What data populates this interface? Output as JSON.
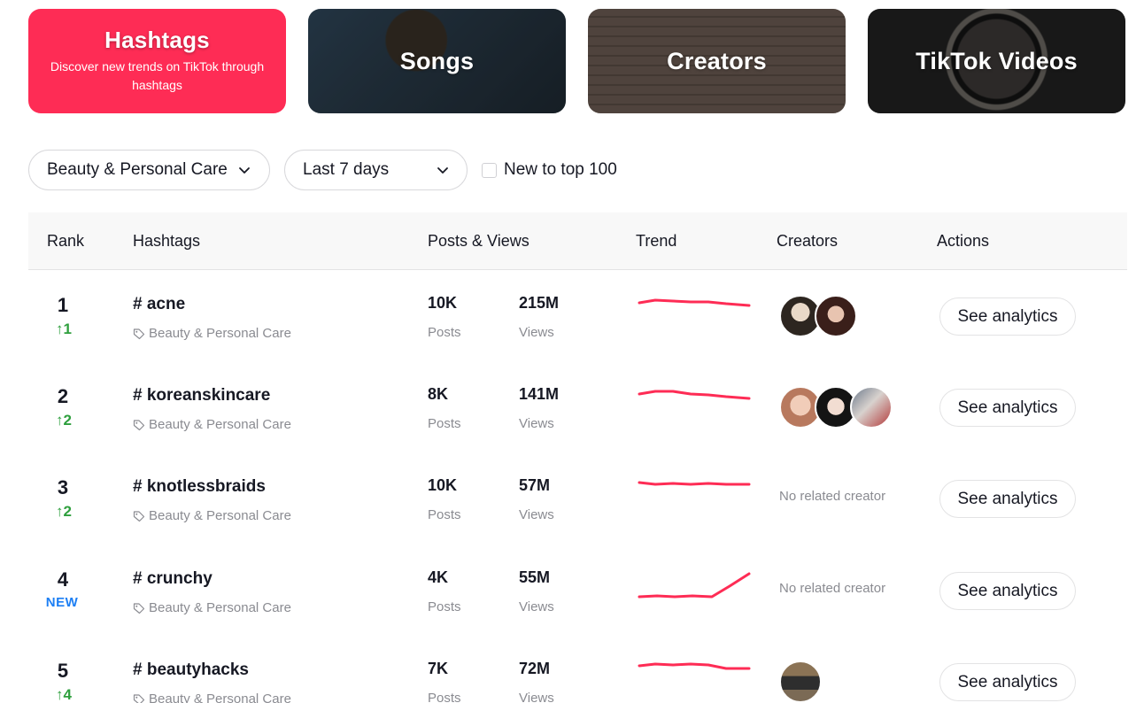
{
  "cards": [
    {
      "title": "Hashtags",
      "subtitle": "Discover new trends on TikTok through hashtags"
    },
    {
      "title": "Songs"
    },
    {
      "title": "Creators"
    },
    {
      "title": "TikTok Videos"
    }
  ],
  "filters": {
    "industry": "Beauty & Personal Care",
    "period": "Last 7 days",
    "new_to_top": "New to top 100"
  },
  "table": {
    "headers": {
      "rank": "Rank",
      "hashtags": "Hashtags",
      "posts_views": "Posts & Views",
      "trend": "Trend",
      "creators": "Creators",
      "actions": "Actions"
    },
    "posts_label": "Posts",
    "views_label": "Views",
    "action_label": "See analytics",
    "no_creator": "No related creator",
    "rows": [
      {
        "rank": "1",
        "change": "↑1",
        "hashtag": "# acne",
        "category": "Beauty & Personal Care",
        "posts": "10K",
        "views": "215M"
      },
      {
        "rank": "2",
        "change": "↑2",
        "hashtag": "# koreanskincare",
        "category": "Beauty & Personal Care",
        "posts": "8K",
        "views": "141M"
      },
      {
        "rank": "3",
        "change": "↑2",
        "hashtag": "# knotlessbraids",
        "category": "Beauty & Personal Care",
        "posts": "10K",
        "views": "57M"
      },
      {
        "rank": "4",
        "change": "NEW",
        "hashtag": "# crunchy",
        "category": "Beauty & Personal Care",
        "posts": "4K",
        "views": "55M"
      },
      {
        "rank": "5",
        "change": "↑4",
        "hashtag": "# beautyhacks",
        "category": "Beauty & Personal Care",
        "posts": "7K",
        "views": "72M"
      }
    ]
  },
  "colors": {
    "accent": "#fe2c55",
    "rank_up": "#2e9f3d",
    "new_badge": "#1d7ff4"
  }
}
